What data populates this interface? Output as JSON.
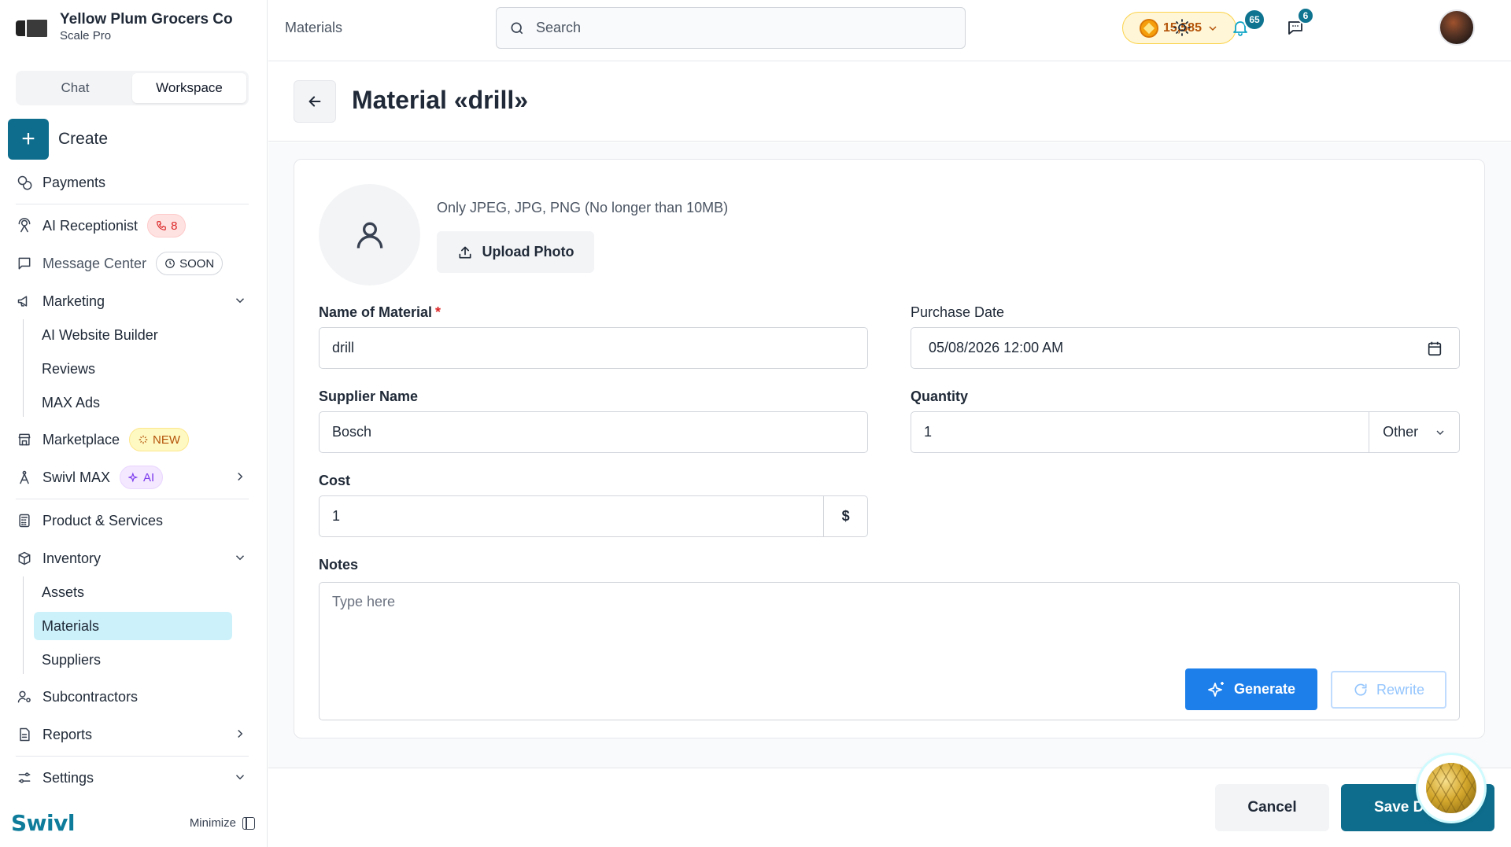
{
  "brand": {
    "name": "Yellow Plum Grocers Co",
    "plan": "Scale Pro"
  },
  "sidebar": {
    "tabs": [
      {
        "label": "Chat",
        "active": false
      },
      {
        "label": "Workspace",
        "active": true
      }
    ],
    "create_label": "Create",
    "items": {
      "payments": "Payments",
      "ai_receptionist": "AI Receptionist",
      "ai_receptionist_badge": "8",
      "message_center": "Message Center",
      "message_center_badge": "SOON",
      "marketing": "Marketing",
      "marketing_sub": [
        "AI Website Builder",
        "Reviews",
        "MAX Ads"
      ],
      "marketplace": "Marketplace",
      "marketplace_badge": "NEW",
      "swivl_max": "Swivl MAX",
      "swivl_max_badge": "AI",
      "products": "Product & Services",
      "inventory": "Inventory",
      "inventory_sub": [
        "Assets",
        "Materials",
        "Suppliers"
      ],
      "inventory_active": "Materials",
      "subcontractors": "Subcontractors",
      "reports": "Reports",
      "settings": "Settings"
    },
    "footer_logo": "Swivl",
    "minimize_label": "Minimize"
  },
  "topbar": {
    "breadcrumb": "Materials",
    "search_placeholder": "Search",
    "coins": "15,585",
    "notifications_count": "65",
    "messages_count": "6"
  },
  "page": {
    "title": "Material «drill»",
    "photo_hint": "Only JPEG, JPG, PNG (No longer than 10MB)",
    "upload_label": "Upload Photo",
    "fields": {
      "name_label": "Name of Material",
      "name_required": "*",
      "name_value": "drill",
      "purchase_date_label": "Purchase Date",
      "purchase_date_value": "05/08/2026 12:00 AM",
      "supplier_label": "Supplier Name",
      "supplier_value": "Bosch",
      "quantity_label": "Quantity",
      "quantity_value": "1",
      "quantity_unit": "Other",
      "cost_label": "Cost",
      "cost_value": "1",
      "cost_currency": "$",
      "notes_label": "Notes",
      "notes_placeholder": "Type here"
    },
    "generate_label": "Generate",
    "rewrite_label": "Rewrite"
  },
  "footer": {
    "cancel_label": "Cancel",
    "save_label": "Save Details"
  },
  "colors": {
    "accent": "#0e6d8c",
    "generate_blue": "#1d7fea",
    "active_nav": "#cdf1fa",
    "badge_red": "#dc2626"
  }
}
